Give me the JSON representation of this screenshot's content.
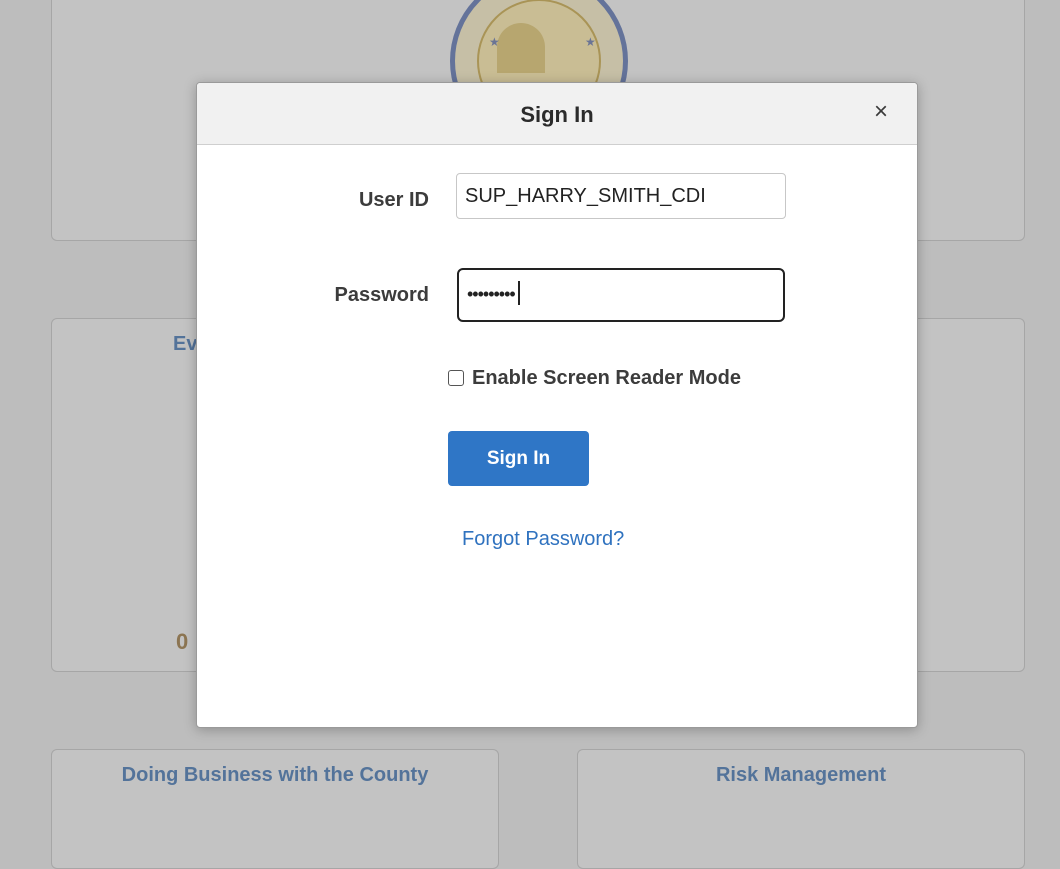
{
  "background": {
    "tiles": [
      {
        "title": ""
      },
      {
        "title": ""
      },
      {
        "title_partial": "Ev",
        "count_partial": "0"
      },
      {
        "title": ""
      },
      {
        "title": "Doing Business with the County"
      },
      {
        "title": "Risk Management"
      }
    ],
    "seal": {
      "icon": "county-seal-logo"
    }
  },
  "modal": {
    "title": "Sign In",
    "close_label": "×",
    "fields": {
      "user_id": {
        "label": "User ID",
        "value": "SUP_HARRY_SMITH_CDI"
      },
      "password": {
        "label": "Password",
        "value": "•••••••••"
      }
    },
    "screen_reader": {
      "label": "Enable Screen Reader Mode",
      "checked": false
    },
    "sign_in_button": "Sign In",
    "forgot_password": "Forgot Password?"
  },
  "colors": {
    "overlay_bg": "#bdbdbd",
    "primary_button": "#2f76c6",
    "link": "#2f72bf",
    "tile_title": "#53739a"
  }
}
